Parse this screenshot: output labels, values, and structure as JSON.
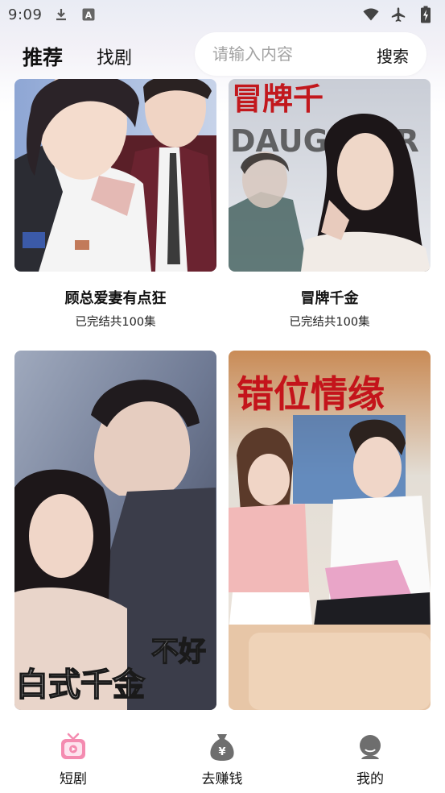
{
  "status_bar": {
    "time": "9:09",
    "icons_left": [
      "download-icon",
      "keyboard-a-icon"
    ],
    "icons_right": [
      "wifi-icon",
      "airplane-icon",
      "battery-charging-icon"
    ]
  },
  "header": {
    "tabs": [
      {
        "label": "推荐",
        "active": true
      },
      {
        "label": "找剧",
        "active": false
      }
    ],
    "search": {
      "placeholder": "请输入内容",
      "value": "",
      "button_label": "搜索"
    }
  },
  "dramas": [
    {
      "title": "顾总爱妻有点狂",
      "status": "已完结共100集",
      "poster_text": ""
    },
    {
      "title": "冒牌千金",
      "status": "已完结共100集",
      "poster_text": "冒牌千金 DAUGHTER"
    },
    {
      "title": "",
      "status": "",
      "poster_text": "不好 白式千金"
    },
    {
      "title": "",
      "status": "",
      "poster_text": "错位情缘"
    }
  ],
  "bottom_nav": [
    {
      "label": "短剧",
      "icon": "tv-icon",
      "active": true
    },
    {
      "label": "去赚钱",
      "icon": "money-bag-icon",
      "active": false
    },
    {
      "label": "我的",
      "icon": "user-icon",
      "active": false
    }
  ],
  "colors": {
    "accent_pink": "#f48bb0",
    "text_primary": "#111111",
    "placeholder": "#a3a3a3"
  }
}
